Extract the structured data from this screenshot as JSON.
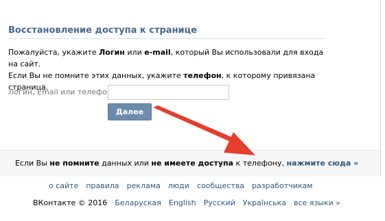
{
  "restore": {
    "title": "Восстановление доступа к странице",
    "intro_line1": {
      "p1": "Пожалуйста, укажите ",
      "b1": "Логин",
      "p2": " или ",
      "b2": "e-mail",
      "p3": ", который Вы использовали для входа на сайт."
    },
    "intro_line2": {
      "p1": "Если Вы не помните этих данных, укажите ",
      "b1": "телефон",
      "p2": ", к которому привязана страница."
    },
    "field_label": "Логин, Email или телефон:",
    "field_value": "",
    "submit_label": "Далее"
  },
  "footer_notice": {
    "p1": "Если Вы ",
    "b1": "не помните",
    "p2": " данных или ",
    "b2": "не имеете доступа",
    "p3": " к телефону, ",
    "link": "нажмите сюда »"
  },
  "bottom_nav": [
    "о сайте",
    "правила",
    "реклама",
    "люди",
    "сообщества",
    "разработчикам"
  ],
  "languages": {
    "copyright": "ВКонтакте © 2016",
    "items": [
      "Беларуская",
      "English",
      "Русский",
      "Українська",
      "все языки »"
    ]
  },
  "colors": {
    "accent": "#45688e",
    "link": "#2b587a",
    "button": "#6d8cad",
    "arrow": "#e53e2e"
  }
}
